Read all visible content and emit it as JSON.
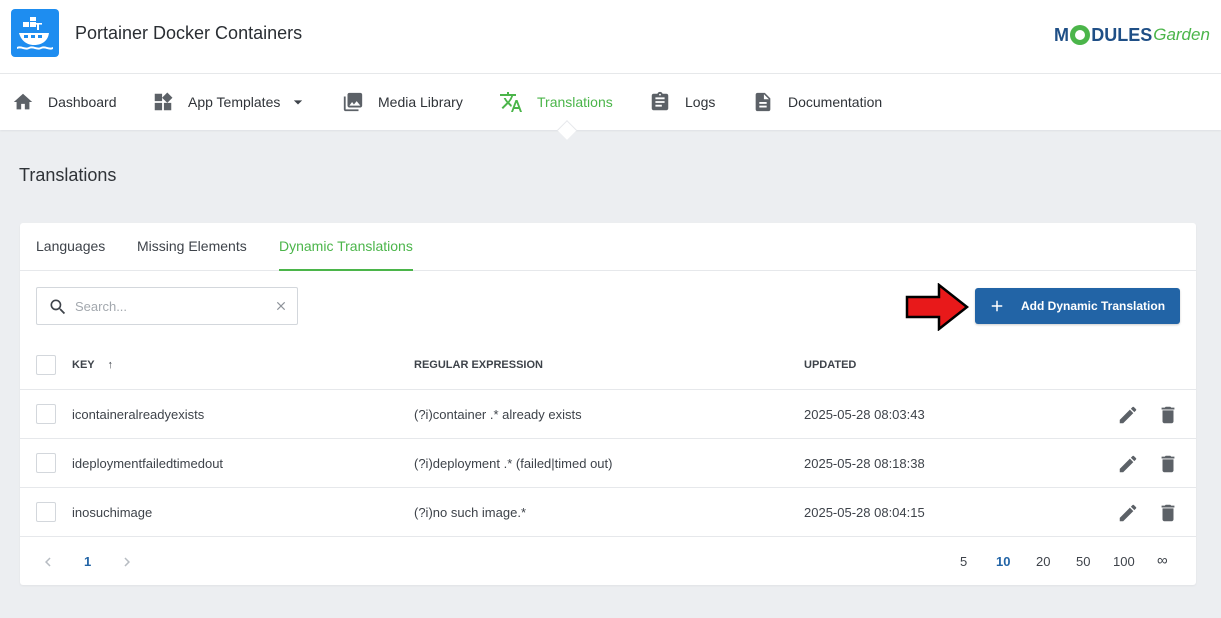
{
  "header": {
    "app_title": "Portainer Docker Containers",
    "brand": {
      "part1": "M",
      "part2": "DULES",
      "part3": "Garden"
    },
    "brand_colors": {
      "blue": "#1f4f86",
      "green": "#4bb54a"
    }
  },
  "nav": {
    "items": [
      {
        "label": "Dashboard",
        "icon": "home-icon"
      },
      {
        "label": "App Templates",
        "icon": "widgets-icon",
        "has_dropdown": true
      },
      {
        "label": "Media Library",
        "icon": "image-library-icon"
      },
      {
        "label": "Translations",
        "icon": "translate-icon",
        "active": true
      },
      {
        "label": "Logs",
        "icon": "clipboard-icon"
      },
      {
        "label": "Documentation",
        "icon": "document-icon"
      }
    ]
  },
  "page": {
    "title": "Translations"
  },
  "tabs": [
    {
      "label": "Languages"
    },
    {
      "label": "Missing Elements"
    },
    {
      "label": "Dynamic Translations",
      "active": true
    }
  ],
  "search": {
    "placeholder": "Search...",
    "value": ""
  },
  "toolbar": {
    "add_label": "Add Dynamic Translation"
  },
  "table": {
    "columns": [
      {
        "label": "KEY",
        "sort": "asc"
      },
      {
        "label": "REGULAR EXPRESSION"
      },
      {
        "label": "UPDATED"
      }
    ],
    "sort_indicator": "↑",
    "rows": [
      {
        "key": "icontaineralreadyexists",
        "regex": "(?i)container .* already exists",
        "updated": "2025-05-28 08:03:43"
      },
      {
        "key": "ideploymentfailedtimedout",
        "regex": "(?i)deployment .* (failed|timed out)",
        "updated": "2025-05-28 08:18:38"
      },
      {
        "key": "inosuchimage",
        "regex": "(?i)no such image.*",
        "updated": "2025-05-28 08:04:15"
      }
    ]
  },
  "pagination": {
    "current_page": "1",
    "page_sizes": [
      "5",
      "10",
      "20",
      "50",
      "100",
      "∞"
    ],
    "active_page_size": "10"
  },
  "colors": {
    "accent_green": "#4bb54a",
    "primary_blue": "#2264a6",
    "arrow_red": "#e8191a",
    "page_bg": "#eceef1"
  }
}
